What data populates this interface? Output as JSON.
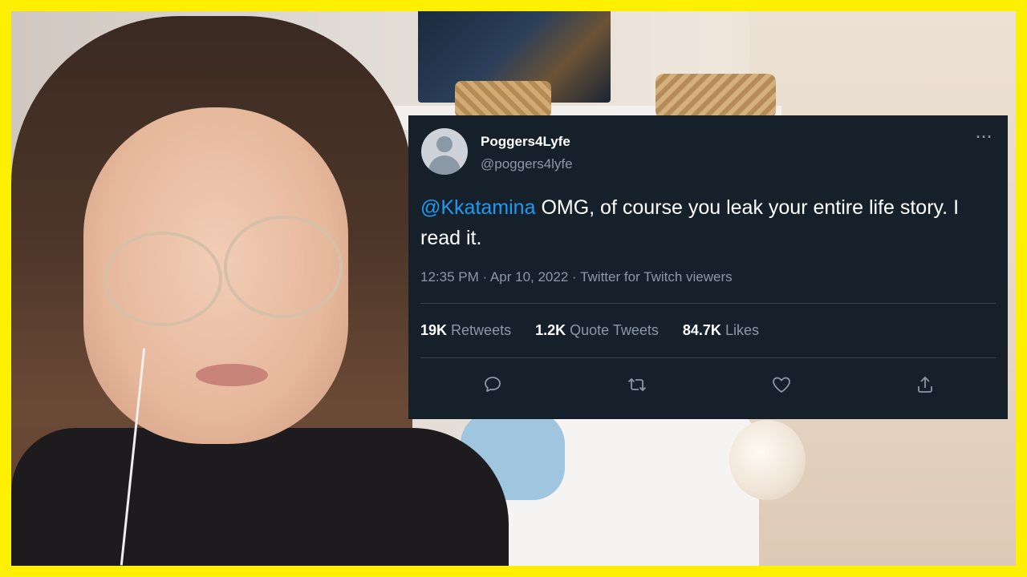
{
  "tweet": {
    "display_name": "Poggers4Lyfe",
    "handle": "@poggers4lyfe",
    "more_label": "···",
    "mention": "@Kkatamina",
    "text": " OMG, of course you leak your entire life story. I read it.",
    "timestamp": "12:35 PM · Apr 10, 2022 · Twitter for Twitch viewers",
    "stats": {
      "retweets_count": "19K",
      "retweets_label": "Retweets",
      "quotes_count": "1.2K",
      "quotes_label": "Quote Tweets",
      "likes_count": "84.7K",
      "likes_label": "Likes"
    },
    "actions": [
      "reply-icon",
      "retweet-icon",
      "like-icon",
      "share-icon"
    ]
  },
  "colors": {
    "frame": "#ffef00",
    "card_bg": "#15202b",
    "mention": "#1d9bf0",
    "muted": "#8b98a5"
  }
}
